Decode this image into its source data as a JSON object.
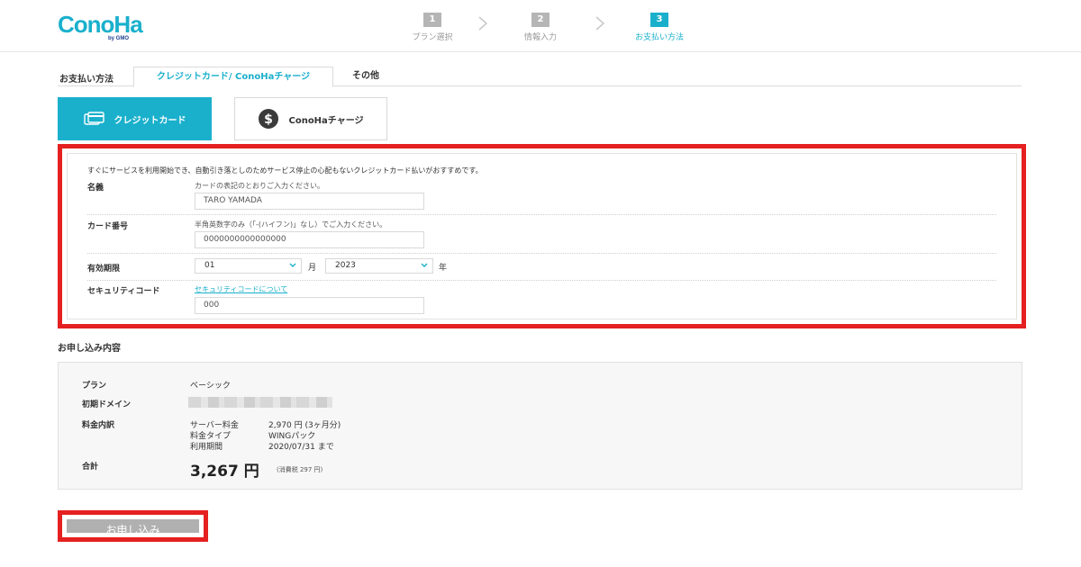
{
  "header": {
    "logo_text": "ConoHa",
    "logo_sub": "by GMO",
    "steps": [
      {
        "num": "1",
        "label": "プラン選択"
      },
      {
        "num": "2",
        "label": "情報入力"
      },
      {
        "num": "3",
        "label": "お支払い方法"
      }
    ],
    "active_step": 3
  },
  "tabs": {
    "lead": "お支払い方法",
    "items": [
      "クレジットカード/ ConoHaチャージ",
      "その他"
    ],
    "active": 0
  },
  "payment_methods": {
    "credit_label": "クレジットカード",
    "charge_label": "ConoHaチャージ"
  },
  "form": {
    "intro": "すぐにサービスを利用開始でき、自動引き落としのためサービス停止の心配もないクレジットカード払いがおすすめです。",
    "name_label": "名義",
    "name_hint": "カードの表記のとおりご入力ください。",
    "name_value": "TARO YAMADA",
    "card_label": "カード番号",
    "card_hint": "半角英数字のみ（「-(ハイフン)」なし）でご入力ください。",
    "card_value": "0000000000000000",
    "expiry_label": "有効期限",
    "expiry_month": "01",
    "month_unit": "月",
    "expiry_year": "2023",
    "year_unit": "年",
    "cvc_label": "セキュリティコード",
    "cvc_link": "セキュリティコードについて",
    "cvc_value": "000"
  },
  "summary": {
    "title": "お申し込み内容",
    "plan_label": "プラン",
    "plan_value": "ベーシック",
    "domain_label": "初期ドメイン",
    "fee_label": "料金内訳",
    "fee_rows": [
      {
        "k": "サーバー料金",
        "v": "2,970 円 (3ヶ月分)"
      },
      {
        "k": "料金タイプ",
        "v": "WINGパック"
      },
      {
        "k": "利用期間",
        "v": "2020/07/31 まで"
      }
    ],
    "total_label": "合計",
    "total_value": "3,267 円",
    "tax_note": "(消費税 297 円)"
  },
  "submit_label": "お申し込み",
  "colors": {
    "accent": "#1ab0cc",
    "highlight": "#e52020",
    "disabled_button": "#b0b0b0"
  }
}
